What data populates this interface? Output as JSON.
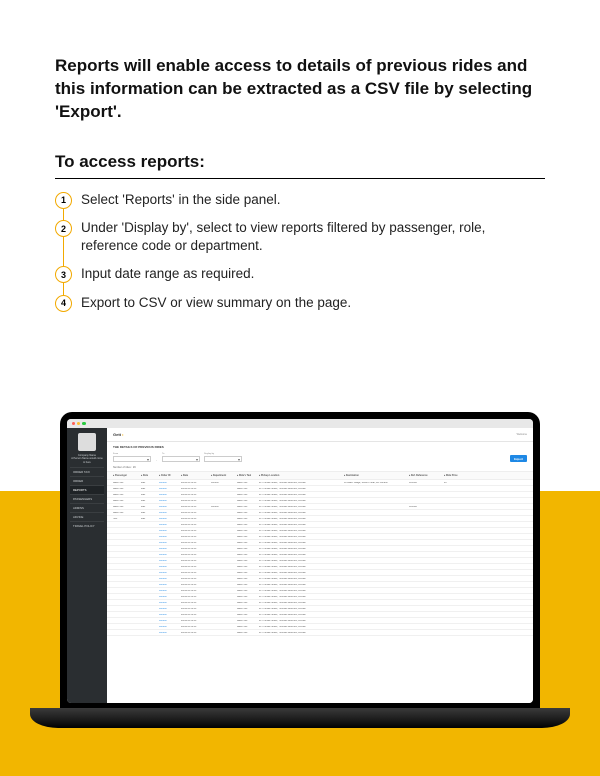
{
  "doc": {
    "intro": "Reports will enable access to details of previous rides and this information can be extracted as a CSV file by selecting 'Export'.",
    "subhead": "To access reports:",
    "steps": [
      "Select 'Reports' in the side panel.",
      "Under 'Display by', select to view reports filtered by passenger, role, reference code or department.",
      "Input date range as required.",
      "Export to CSV or view summary on the page."
    ]
  },
  "app": {
    "brand": "Gett",
    "welcome": "Welcome",
    "company_name": "Company Name",
    "company_sub": "A Person Name would come in here",
    "nav": [
      "ORDER TAXI",
      "ORDER",
      "REPORTS",
      "PASSENGERS",
      "ADMINS",
      "ADVICE",
      "TRAVEL POLICY"
    ],
    "page_title": "THE DETAILS OF PREVIOUS RIDES",
    "filters": {
      "from_label": "From",
      "to_label": "To",
      "display_label": "Display by"
    },
    "export_label": "Export",
    "count": "Number of rides : 29",
    "columns": [
      "Passenger",
      "Role",
      "Order ID",
      "Date",
      "Department",
      "Ride's Taxi",
      "Pickup Location",
      "Destination",
      "Ref. Reference",
      "Ride Price"
    ],
    "rows": [
      {
        "p": "Black Taxi",
        "r": "staff",
        "o": "000000",
        "d": "28/06/14 00:00",
        "dep": "000000",
        "t": "Black Taxi",
        "pu": "21 Thomas Street, Thomas Street E1, London",
        "de": "18 Black Village, Street 2 near, W1 London",
        "ref": "JD3000",
        "pr": "26"
      },
      {
        "p": "Black Taxi",
        "r": "staff",
        "o": "000000",
        "d": "28/06/14 00:00",
        "dep": "",
        "t": "Black Taxi",
        "pu": "21 Thomas Street, Thomas Street E1, London",
        "de": "",
        "ref": "",
        "pr": ""
      },
      {
        "p": "Black Taxi",
        "r": "staff",
        "o": "000000",
        "d": "28/06/14 00:00",
        "dep": "",
        "t": "Black Taxi",
        "pu": "21 Thomas Street, Thomas Street E1, London",
        "de": "",
        "ref": "",
        "pr": ""
      },
      {
        "p": "Black Taxi",
        "r": "staff",
        "o": "000000",
        "d": "28/06/14 00:00",
        "dep": "",
        "t": "Black Taxi",
        "pu": "21 Thomas Street, Thomas Street E1, London",
        "de": "",
        "ref": "",
        "pr": ""
      },
      {
        "p": "Black Taxi",
        "r": "staff",
        "o": "000000",
        "d": "28/06/14 00:00",
        "dep": "000000",
        "t": "Black Taxi",
        "pu": "21 Thomas Street, Thomas Street E1, London",
        "de": "",
        "ref": "JD3000",
        "pr": ""
      },
      {
        "p": "Black Taxi",
        "r": "staff",
        "o": "000000",
        "d": "28/06/14 00:00",
        "dep": "",
        "t": "Black Taxi",
        "pu": "21 Thomas Street, Thomas Street E1, London",
        "de": "",
        "ref": "",
        "pr": ""
      },
      {
        "p": "Test",
        "r": "staff",
        "o": "000000",
        "d": "28/06/14 00:00",
        "dep": "",
        "t": "Black Taxi",
        "pu": "21 Thomas Street, Thomas Street E1, London",
        "de": "",
        "ref": "",
        "pr": ""
      },
      {
        "p": "",
        "r": "",
        "o": "000000",
        "d": "28/06/14 00:00",
        "dep": "",
        "t": "Black Taxi",
        "pu": "21 Thomas Street, Thomas Street E1, London",
        "de": "",
        "ref": "",
        "pr": ""
      },
      {
        "p": "",
        "r": "",
        "o": "000000",
        "d": "28/06/14 00:00",
        "dep": "",
        "t": "Black Taxi",
        "pu": "21 Thomas Street, Thomas Street E1, London",
        "de": "",
        "ref": "",
        "pr": ""
      },
      {
        "p": "",
        "r": "",
        "o": "000000",
        "d": "28/06/14 00:00",
        "dep": "",
        "t": "Black Taxi",
        "pu": "21 Thomas Street, Thomas Street E1, London",
        "de": "",
        "ref": "",
        "pr": ""
      },
      {
        "p": "",
        "r": "",
        "o": "000000",
        "d": "28/06/14 00:00",
        "dep": "",
        "t": "Black Taxi",
        "pu": "21 Thomas Street, Thomas Street E1, London",
        "de": "",
        "ref": "",
        "pr": ""
      },
      {
        "p": "",
        "r": "",
        "o": "000000",
        "d": "28/06/14 00:00",
        "dep": "",
        "t": "Black Taxi",
        "pu": "21 Thomas Street, Thomas Street E1, London",
        "de": "",
        "ref": "",
        "pr": ""
      },
      {
        "p": "",
        "r": "",
        "o": "000000",
        "d": "28/06/14 00:00",
        "dep": "",
        "t": "Black Taxi",
        "pu": "21 Thomas Street, Thomas Street E1, London",
        "de": "",
        "ref": "",
        "pr": ""
      },
      {
        "p": "",
        "r": "",
        "o": "000000",
        "d": "28/06/14 00:00",
        "dep": "",
        "t": "Black Taxi",
        "pu": "21 Thomas Street, Thomas Street E1, London",
        "de": "",
        "ref": "",
        "pr": ""
      },
      {
        "p": "",
        "r": "",
        "o": "000000",
        "d": "28/06/14 00:00",
        "dep": "",
        "t": "Black Taxi",
        "pu": "21 Thomas Street, Thomas Street E1, London",
        "de": "",
        "ref": "",
        "pr": ""
      },
      {
        "p": "",
        "r": "",
        "o": "000000",
        "d": "28/06/14 00:00",
        "dep": "",
        "t": "Black Taxi",
        "pu": "21 Thomas Street, Thomas Street E1, London",
        "de": "",
        "ref": "",
        "pr": ""
      },
      {
        "p": "",
        "r": "",
        "o": "000000",
        "d": "28/06/14 00:00",
        "dep": "",
        "t": "Black Taxi",
        "pu": "21 Thomas Street, Thomas Street E1, London",
        "de": "",
        "ref": "",
        "pr": ""
      },
      {
        "p": "",
        "r": "",
        "o": "000000",
        "d": "28/06/14 00:00",
        "dep": "",
        "t": "Black Taxi",
        "pu": "21 Thomas Street, Thomas Street E1, London",
        "de": "",
        "ref": "",
        "pr": ""
      },
      {
        "p": "",
        "r": "",
        "o": "000000",
        "d": "28/06/14 00:00",
        "dep": "",
        "t": "Black Taxi",
        "pu": "21 Thomas Street, Thomas Street E1, London",
        "de": "",
        "ref": "",
        "pr": ""
      },
      {
        "p": "",
        "r": "",
        "o": "000000",
        "d": "28/06/14 00:00",
        "dep": "",
        "t": "Black Taxi",
        "pu": "21 Thomas Street, Thomas Street E1, London",
        "de": "",
        "ref": "",
        "pr": ""
      },
      {
        "p": "",
        "r": "",
        "o": "000000",
        "d": "28/06/14 00:00",
        "dep": "",
        "t": "Black Taxi",
        "pu": "21 Thomas Street, Thomas Street E1, London",
        "de": "",
        "ref": "",
        "pr": ""
      },
      {
        "p": "",
        "r": "",
        "o": "000000",
        "d": "28/06/14 00:00",
        "dep": "",
        "t": "Black Taxi",
        "pu": "21 Thomas Street, Thomas Street E1, London",
        "de": "",
        "ref": "",
        "pr": ""
      },
      {
        "p": "",
        "r": "",
        "o": "000000",
        "d": "28/06/14 00:00",
        "dep": "",
        "t": "Black Taxi",
        "pu": "21 Thomas Street, Thomas Street E1, London",
        "de": "",
        "ref": "",
        "pr": ""
      },
      {
        "p": "",
        "r": "",
        "o": "000000",
        "d": "28/06/14 00:00",
        "dep": "",
        "t": "Black Taxi",
        "pu": "21 Thomas Street, Thomas Street E1, London",
        "de": "",
        "ref": "",
        "pr": ""
      },
      {
        "p": "",
        "r": "",
        "o": "000000",
        "d": "28/06/14 00:00",
        "dep": "",
        "t": "Black Taxi",
        "pu": "21 Thomas Street, Thomas Street E1, London",
        "de": "",
        "ref": "",
        "pr": ""
      },
      {
        "p": "",
        "r": "",
        "o": "000000",
        "d": "28/06/14 00:00",
        "dep": "",
        "t": "Black Taxi",
        "pu": "21 Thomas Street, Thomas Street E1, London",
        "de": "",
        "ref": "",
        "pr": ""
      }
    ]
  }
}
